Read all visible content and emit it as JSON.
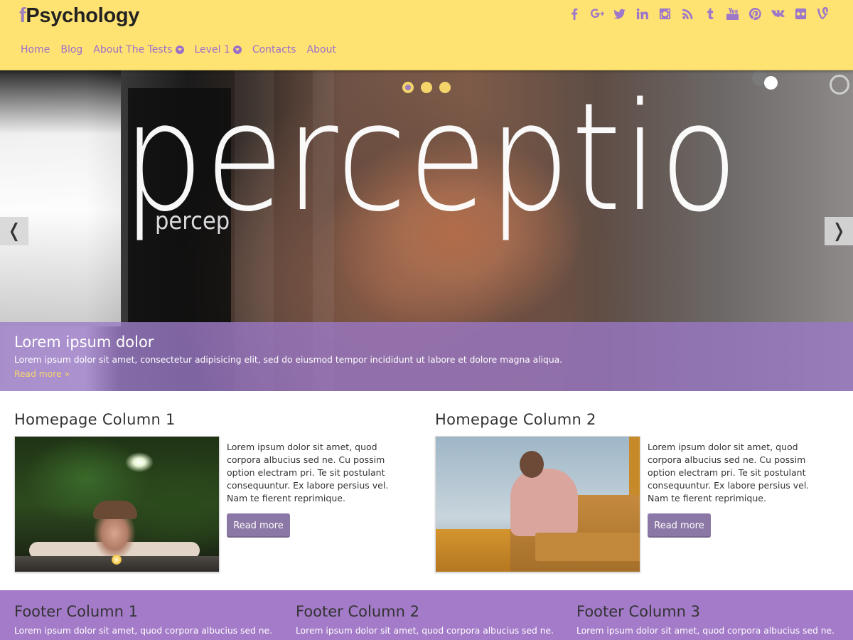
{
  "header": {
    "logo_prefix": "f",
    "logo_text": "Psychology",
    "nav": [
      {
        "label": "Home"
      },
      {
        "label": "Blog"
      },
      {
        "label": "About The Tests",
        "dropdown": true
      },
      {
        "label": "Level 1",
        "dropdown": true
      },
      {
        "label": "Contacts"
      },
      {
        "label": "About"
      }
    ],
    "social_icons": [
      "facebook-icon",
      "google-plus-icon",
      "twitter-icon",
      "linkedin-icon",
      "instagram-icon",
      "rss-icon",
      "tumblr-icon",
      "youtube-icon",
      "pinterest-icon",
      "vk-icon",
      "flickr-icon",
      "vine-icon"
    ]
  },
  "slider": {
    "big_word": "perceptio",
    "small_word": "percep",
    "caption_title": "Lorem ipsum dolor",
    "caption_text": "Lorem ipsum dolor sit amet, consectetur adipisicing elit, sed do eiusmod tempor incididunt ut labore et dolore magna aliqua.",
    "caption_more": "Read more »",
    "prev_glyph": "❬",
    "next_glyph": "❭",
    "dots": 3,
    "active_dot": 0
  },
  "columns": [
    {
      "title": "Homepage Column 1",
      "text": "Lorem ipsum dolor sit amet, quod corpora albucius sed ne. Cu possim option electram pri. Te sit postulant consequuntur. Ex labore persius vel. Nam te fierent reprimique.",
      "button": "Read more"
    },
    {
      "title": "Homepage Column 2",
      "text": "Lorem ipsum dolor sit amet, quod corpora albucius sed ne. Cu possim option electram pri. Te sit postulant consequuntur. Ex labore persius vel. Nam te fierent reprimique.",
      "button": "Read more"
    }
  ],
  "footer": [
    {
      "title": "Footer Column 1",
      "text": "Lorem ipsum dolor sit amet, quod corpora albucius sed ne."
    },
    {
      "title": "Footer Column 2",
      "text": "Lorem ipsum dolor sit amet, quod corpora albucius sed ne."
    },
    {
      "title": "Footer Column 3",
      "text": "Lorem ipsum dolor sit amet, quod corpora albucius sed ne."
    }
  ],
  "colors": {
    "header_bg": "#ffe372",
    "accent_purple": "#9b6fc9",
    "caption_bg": "#9b78c8",
    "footer_bg": "#a47bc8",
    "button_bg": "#8c78a6",
    "link_yellow": "#f5d56b"
  }
}
